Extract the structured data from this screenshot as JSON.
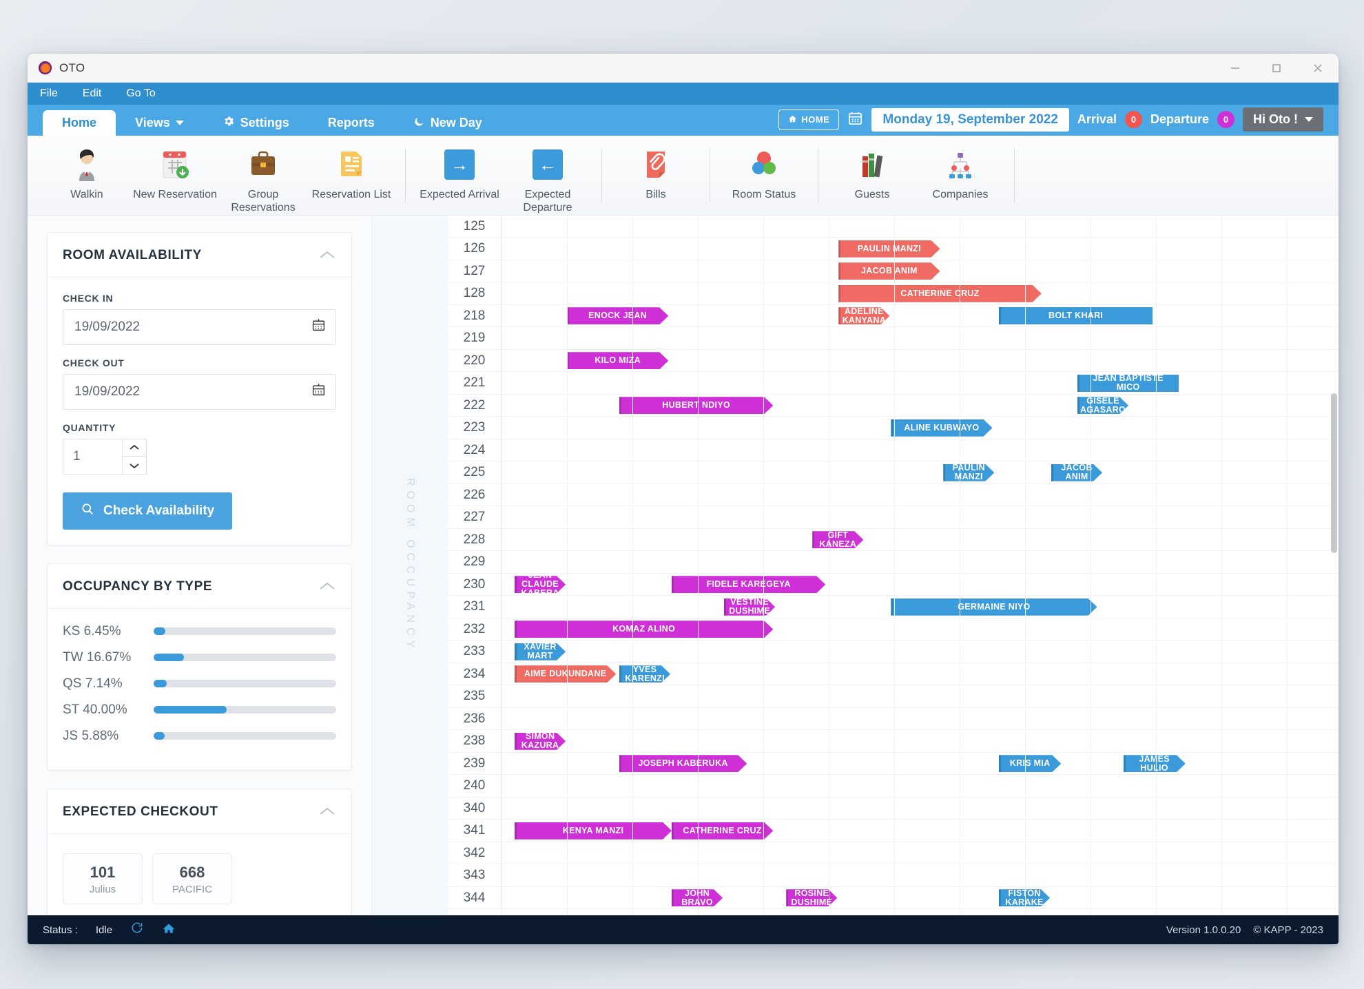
{
  "window": {
    "app_title": "OTO",
    "logo_icon": "oto-logo",
    "minimize_icon": "minimize-icon",
    "maximize_icon": "maximize-icon",
    "close_icon": "close-icon"
  },
  "menubar": {
    "items": [
      "File",
      "Edit",
      "Go To"
    ]
  },
  "tabs": [
    {
      "label": "Home",
      "active": true
    },
    {
      "label": "Views",
      "icon": "chevron-down-icon",
      "active": false
    },
    {
      "label": "Settings",
      "icon": "gear-icon",
      "active": false
    },
    {
      "label": "Reports",
      "active": false
    },
    {
      "label": "New Day",
      "icon": "moon-icon",
      "active": false
    }
  ],
  "header": {
    "home_button": "HOME",
    "home_icon": "home-icon",
    "calendar_icon": "calendar-icon",
    "date": "Monday 19, September 2022",
    "arrival_label": "Arrival",
    "arrival_count": "0",
    "departure_label": "Departure",
    "departure_count": "0",
    "user_label": "Hi Oto !",
    "user_chevron": "chevron-down-icon",
    "arrival_color": "#f2544f",
    "departure_color": "#cf2fd6"
  },
  "toolbar": {
    "items": [
      {
        "label": "Walkin",
        "icon": "person-icon"
      },
      {
        "label": "New\nReservation",
        "icon": "calendar-add-icon"
      },
      {
        "label": "Group\nReservations",
        "icon": "briefcase-icon"
      },
      {
        "label": "Reservation\nList",
        "icon": "document-list-icon"
      },
      {
        "label": "Expected\nArrival",
        "icon": "arrow-right-icon"
      },
      {
        "label": "Expected\nDeparture",
        "icon": "arrow-left-icon"
      },
      {
        "label": "Bills",
        "icon": "paperclip-document-icon"
      },
      {
        "label": "Room\nStatus",
        "icon": "venn-circles-icon"
      },
      {
        "label": "Guests",
        "icon": "books-icon"
      },
      {
        "label": "Companies",
        "icon": "org-chart-icon"
      }
    ]
  },
  "sidebar": {
    "room_availability": {
      "title": "ROOM AVAILABILITY",
      "collapse_icon": "caret-up-icon",
      "check_in_label": "CHECK IN",
      "check_in_value": "19/09/2022",
      "check_out_label": "CHECK OUT",
      "check_out_value": "19/09/2022",
      "quantity_label": "QUANTITY",
      "quantity_value": "1",
      "calendar_icon": "calendar-icon",
      "button_label": "Check Availability",
      "button_icon": "search-icon"
    },
    "occupancy_by_type": {
      "title": "OCCUPANCY BY TYPE",
      "collapse_icon": "caret-up-icon",
      "rows": [
        {
          "label": "KS 6.45%",
          "value": 6.45
        },
        {
          "label": "TW 16.67%",
          "value": 16.67
        },
        {
          "label": "QS 7.14%",
          "value": 7.14
        },
        {
          "label": "ST 40.00%",
          "value": 40.0
        },
        {
          "label": "JS 5.88%",
          "value": 5.88
        }
      ]
    },
    "expected_checkout": {
      "title": "EXPECTED CHECKOUT",
      "collapse_icon": "caret-up-icon",
      "tiles": [
        {
          "number": "101",
          "name": "Julius"
        },
        {
          "number": "668",
          "name": "PACIFIC"
        }
      ]
    }
  },
  "gantt": {
    "vertical_label": "ROOM OCCUPANCY",
    "column_count": 13,
    "rows": [
      {
        "room": "125",
        "bars": []
      },
      {
        "room": "126",
        "bars": [
          {
            "name": "PAULIN MANZI",
            "color": "red",
            "start": 5.15,
            "span": 1.55
          }
        ]
      },
      {
        "room": "127",
        "bars": [
          {
            "name": "JACOB ANIM",
            "color": "red",
            "start": 5.15,
            "span": 1.55
          }
        ]
      },
      {
        "room": "128",
        "bars": [
          {
            "name": "CATHERINE CRUZ",
            "color": "red",
            "start": 5.15,
            "span": 3.1
          }
        ]
      },
      {
        "room": "218",
        "bars": [
          {
            "name": "ENOCK JEAN",
            "color": "magenta",
            "start": 1.0,
            "span": 1.55
          },
          {
            "name": "ADELINE\nKANYANA",
            "color": "red",
            "start": 5.15,
            "span": 0.78
          },
          {
            "name": "BOLT KHARI",
            "color": "blue",
            "start": 7.6,
            "span": 2.35,
            "square": true
          }
        ]
      },
      {
        "room": "219",
        "bars": []
      },
      {
        "room": "220",
        "bars": [
          {
            "name": "KILO MIZA",
            "color": "magenta",
            "start": 1.0,
            "span": 1.55
          }
        ]
      },
      {
        "room": "221",
        "bars": [
          {
            "name": "JEAN BAPTISTE MICO",
            "color": "blue",
            "start": 8.8,
            "span": 1.55,
            "square": true
          }
        ]
      },
      {
        "room": "222",
        "bars": [
          {
            "name": "HUBERT NDIYO",
            "color": "magenta",
            "start": 1.8,
            "span": 2.35
          },
          {
            "name": "GISELE\nAGASARO",
            "color": "blue",
            "start": 8.8,
            "span": 0.78
          }
        ]
      },
      {
        "room": "223",
        "bars": [
          {
            "name": "ALINE KUBWAYO",
            "color": "blue",
            "start": 5.95,
            "span": 1.55
          }
        ]
      },
      {
        "room": "224",
        "bars": []
      },
      {
        "room": "225",
        "bars": [
          {
            "name": "PAULIN\nMANZI",
            "color": "blue",
            "start": 6.75,
            "span": 0.78
          },
          {
            "name": "JACOB\nANIM",
            "color": "blue",
            "start": 8.4,
            "span": 0.78
          }
        ]
      },
      {
        "room": "226",
        "bars": []
      },
      {
        "room": "227",
        "bars": []
      },
      {
        "room": "228",
        "bars": [
          {
            "name": "GIFT\nKANEZA",
            "color": "magenta",
            "start": 4.75,
            "span": 0.78
          }
        ]
      },
      {
        "room": "229",
        "bars": []
      },
      {
        "room": "230",
        "bars": [
          {
            "name": "JEAN\nCLAUDE\nKABERA",
            "color": "magenta",
            "start": 0.2,
            "span": 0.78
          },
          {
            "name": "FIDELE KAREGEYA",
            "color": "magenta",
            "start": 2.6,
            "span": 2.35
          }
        ]
      },
      {
        "room": "231",
        "bars": [
          {
            "name": "VESTINE\nDUSHIME",
            "color": "magenta",
            "start": 3.4,
            "span": 0.78
          },
          {
            "name": "GERMAINE NIYO",
            "color": "blue",
            "start": 5.95,
            "span": 3.15
          }
        ]
      },
      {
        "room": "232",
        "bars": [
          {
            "name": "KOMAZ ALINO",
            "color": "magenta",
            "start": 0.2,
            "span": 3.95
          }
        ]
      },
      {
        "room": "233",
        "bars": [
          {
            "name": "XAVIER\nMART",
            "color": "blue",
            "start": 0.2,
            "span": 0.78
          }
        ]
      },
      {
        "room": "234",
        "bars": [
          {
            "name": "AIME DUKUNDANE",
            "color": "red",
            "start": 0.2,
            "span": 1.55
          },
          {
            "name": "YVES\nKARENZI",
            "color": "blue",
            "start": 1.8,
            "span": 0.78
          }
        ]
      },
      {
        "room": "235",
        "bars": []
      },
      {
        "room": "236",
        "bars": []
      },
      {
        "room": "238",
        "bars": [
          {
            "name": "SIMON\nKAZURA",
            "color": "magenta",
            "start": 0.2,
            "span": 0.78
          }
        ]
      },
      {
        "room": "239",
        "bars": [
          {
            "name": "JOSEPH KABERUKA",
            "color": "magenta",
            "start": 1.8,
            "span": 1.95
          },
          {
            "name": "KRIS MIA",
            "color": "blue",
            "start": 7.6,
            "span": 0.95
          },
          {
            "name": "JAMES\nHULIO",
            "color": "blue",
            "start": 9.5,
            "span": 0.95
          }
        ]
      },
      {
        "room": "240",
        "bars": []
      },
      {
        "room": "340",
        "bars": []
      },
      {
        "room": "341",
        "bars": [
          {
            "name": "KENYA MANZI",
            "color": "magenta",
            "start": 0.2,
            "span": 2.4
          },
          {
            "name": "CATHERINE CRUZ",
            "color": "magenta",
            "start": 2.6,
            "span": 1.55
          }
        ]
      },
      {
        "room": "342",
        "bars": []
      },
      {
        "room": "343",
        "bars": []
      },
      {
        "room": "344",
        "bars": [
          {
            "name": "JOHN\nBRAVO",
            "color": "magenta",
            "start": 2.6,
            "span": 0.78
          },
          {
            "name": "ROSINE\nDUSHIME",
            "color": "magenta",
            "start": 4.35,
            "span": 0.78
          },
          {
            "name": "FISTON\nKARAKE",
            "color": "blue",
            "start": 7.6,
            "span": 0.78
          }
        ]
      }
    ]
  },
  "statusbar": {
    "status_label": "Status :",
    "status_value": "Idle",
    "refresh_icon": "refresh-icon",
    "home_icon": "home-icon",
    "version": "Version 1.0.0.20",
    "copyright": "© KAPP - 2023"
  }
}
